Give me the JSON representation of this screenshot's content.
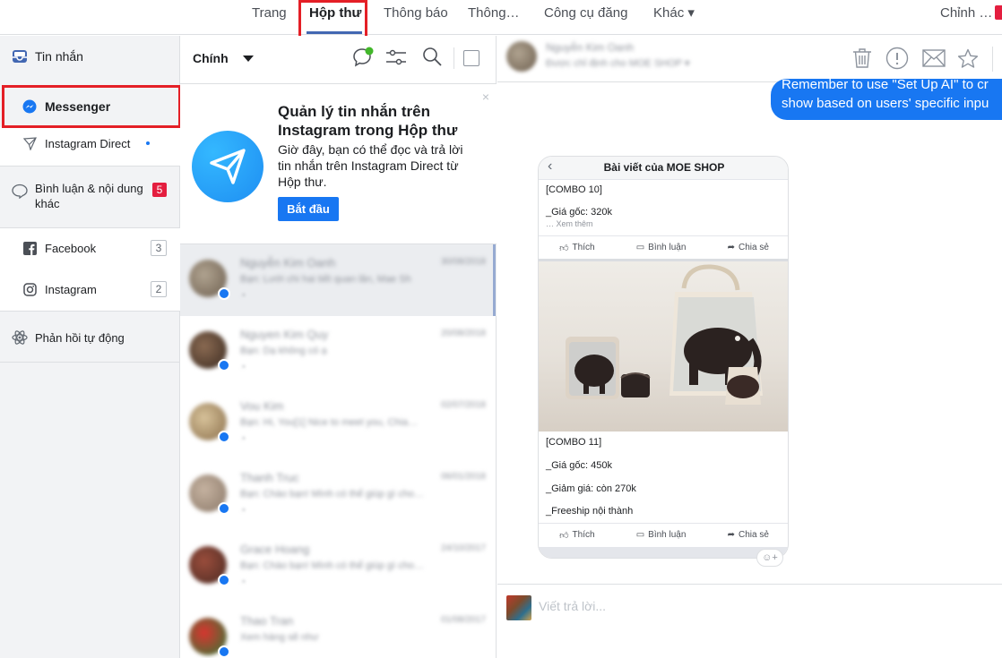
{
  "topnav": {
    "tabs": [
      "Trang",
      "Hộp thư",
      "Thông báo",
      "Thông…",
      "Công cụ đăng",
      "Khác ▾"
    ],
    "right_label": "Chỉnh …"
  },
  "sidebar": {
    "section_title": "Tin nhắn",
    "messenger": "Messenger",
    "instagram_direct": "Instagram Direct",
    "comments": "Bình luận & nội dung khác",
    "comments_count": "5",
    "facebook": "Facebook",
    "facebook_count": "3",
    "instagram": "Instagram",
    "instagram_count": "2",
    "auto_reply": "Phản hồi tự động"
  },
  "middle": {
    "filter_label": "Chính",
    "promo": {
      "title": "Quản lý tin nhắn trên Instagram trong Hộp thư",
      "desc": "Giờ đây, bạn có thể đọc và trả lời tin nhắn trên Instagram Direct từ Hộp thư.",
      "button": "Bắt đầu",
      "close": "×"
    },
    "conversations": [
      {
        "name": "Nguyễn Kim Oanh",
        "date": "30/08/2018",
        "snippet": "Bạn: Lưới chi hai tiết quan lăn, Mae Sh"
      },
      {
        "name": "Nguyen Kim Quy",
        "date": "20/08/2018",
        "snippet": "Bạn: Dạ không có ạ"
      },
      {
        "name": "Vou Kim",
        "date": "02/07/2018",
        "snippet": "Bạn: Hi, You[1] Nice to meet you, Chia…"
      },
      {
        "name": "Thanh Truc",
        "date": "06/01/2018",
        "snippet": "Bạn: Chào bạn! Mình có thể giúp gì cho…"
      },
      {
        "name": "Grace Hoang",
        "date": "24/10/2017",
        "snippet": "Bạn: Chào bạn! Mình có thể giúp gì cho…"
      },
      {
        "name": "Thao Tran",
        "date": "01/08/2017",
        "snippet": "Xem hàng sẽ như"
      }
    ]
  },
  "right": {
    "contact_name": "Nguyễn Kim Oanh",
    "contact_sub": "Được chỉ định cho MOE SHOP ▾",
    "bubble_line1": "Remember to use \"Set Up AI\" to cr",
    "bubble_line2": "show based on users' specific inpu",
    "post": {
      "title": "Bài viết của MOE SHOP",
      "back": "‹",
      "combo10": "[COMBO 10]",
      "price10": "_Giá gốc: 320k",
      "more": "… Xem thêm",
      "combo11": "[COMBO 11]",
      "price11": "_Giá gốc: 450k",
      "discount11": "_Giảm giá: còn 270k",
      "freeship": "_Freeship nội thành",
      "like": "Thích",
      "comment": "Bình luận",
      "share": "Chia sẻ"
    },
    "react": "☺+",
    "composer_placeholder": "Viết trả lời..."
  }
}
